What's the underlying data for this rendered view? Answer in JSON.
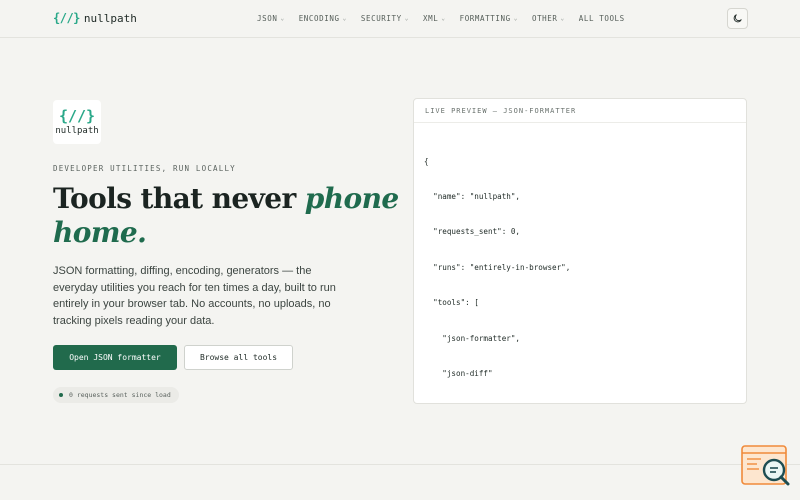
{
  "brand": {
    "mark": "{//}",
    "name": "nullpath"
  },
  "nav": [
    {
      "label": "JSON",
      "caret": "⌄"
    },
    {
      "label": "ENCODING",
      "caret": "⌄"
    },
    {
      "label": "SECURITY",
      "caret": "⌄"
    },
    {
      "label": "XML",
      "caret": "⌄"
    },
    {
      "label": "FORMATTING",
      "caret": "⌄"
    },
    {
      "label": "OTHER",
      "caret": "⌄"
    },
    {
      "label": "ALL TOOLS"
    }
  ],
  "theme_toggle": {
    "icon": "moon-icon"
  },
  "hero": {
    "logo_mark": "{//}",
    "logo_name": "nullpath",
    "eyebrow": "DEVELOPER UTILITIES, RUN LOCALLY",
    "headline_plain": "Tools that never ",
    "headline_accent": "phone home.",
    "lede": "JSON formatting, diffing, encoding, generators — the everyday utilities you reach for ten times a day, built to run entirely in your browser tab. No accounts, no uploads, no tracking pixels reading your data.",
    "primary_button": "Open JSON formatter",
    "secondary_button": "Browse all tools",
    "status_pill": "0 requests sent since load"
  },
  "preview": {
    "title": "LIVE PREVIEW — JSON-FORMATTER",
    "code_lines": [
      "{",
      "  \"name\": \"nullpath\",",
      "  \"requests_sent\": 0,",
      "  \"runs\": \"entirely-in-browser\",",
      "  \"tools\": [",
      "    \"json-formatter\",",
      "    \"json-diff\"",
      "  ]",
      "}"
    ]
  },
  "colors": {
    "accent": "#216a4c",
    "brand_mark": "#2aa889",
    "headline_accent": "#1f6b4e",
    "background": "#f4f4f1"
  }
}
